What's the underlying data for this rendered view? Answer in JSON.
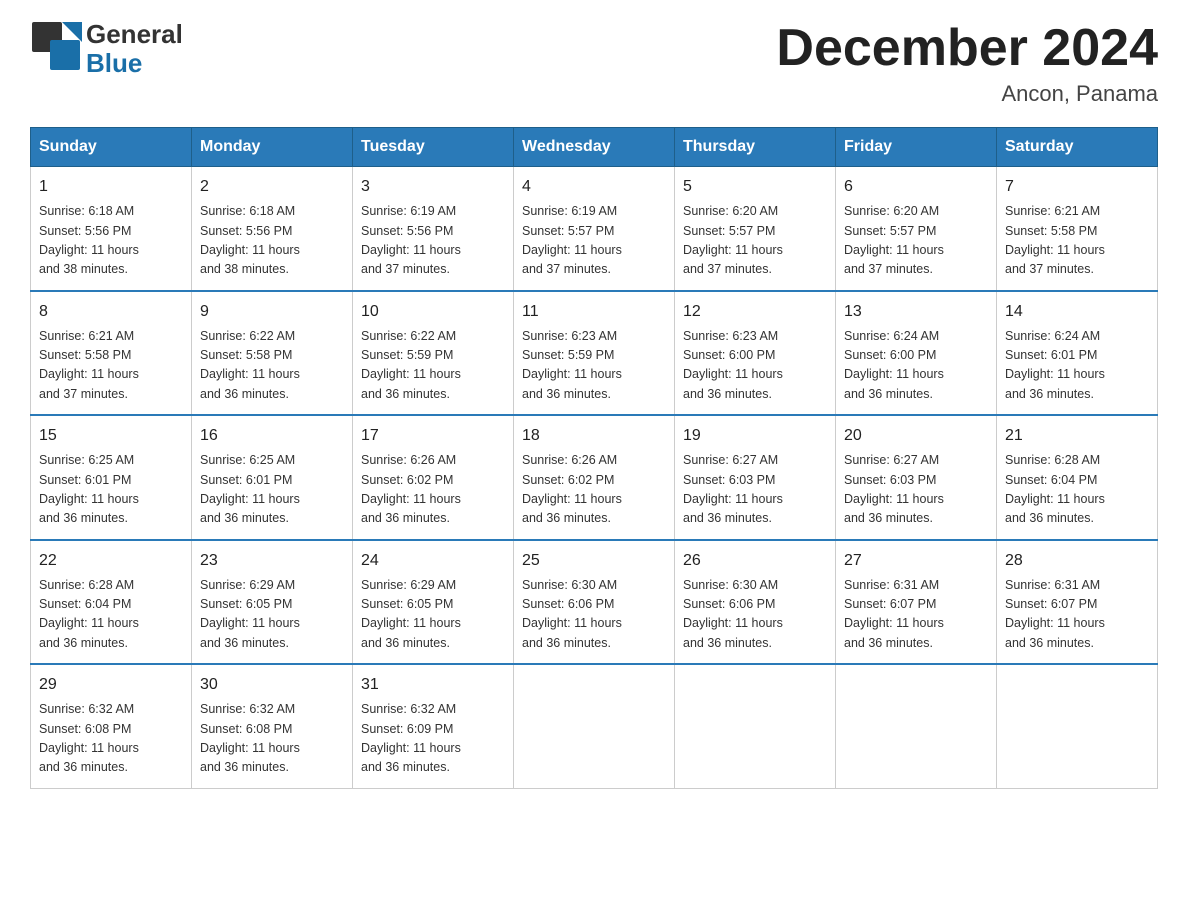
{
  "logo": {
    "general": "General",
    "blue": "Blue"
  },
  "title": "December 2024",
  "subtitle": "Ancon, Panama",
  "days_header": [
    "Sunday",
    "Monday",
    "Tuesday",
    "Wednesday",
    "Thursday",
    "Friday",
    "Saturday"
  ],
  "weeks": [
    [
      {
        "day": "1",
        "sunrise": "6:18 AM",
        "sunset": "5:56 PM",
        "daylight": "11 hours and 38 minutes."
      },
      {
        "day": "2",
        "sunrise": "6:18 AM",
        "sunset": "5:56 PM",
        "daylight": "11 hours and 38 minutes."
      },
      {
        "day": "3",
        "sunrise": "6:19 AM",
        "sunset": "5:56 PM",
        "daylight": "11 hours and 37 minutes."
      },
      {
        "day": "4",
        "sunrise": "6:19 AM",
        "sunset": "5:57 PM",
        "daylight": "11 hours and 37 minutes."
      },
      {
        "day": "5",
        "sunrise": "6:20 AM",
        "sunset": "5:57 PM",
        "daylight": "11 hours and 37 minutes."
      },
      {
        "day": "6",
        "sunrise": "6:20 AM",
        "sunset": "5:57 PM",
        "daylight": "11 hours and 37 minutes."
      },
      {
        "day": "7",
        "sunrise": "6:21 AM",
        "sunset": "5:58 PM",
        "daylight": "11 hours and 37 minutes."
      }
    ],
    [
      {
        "day": "8",
        "sunrise": "6:21 AM",
        "sunset": "5:58 PM",
        "daylight": "11 hours and 37 minutes."
      },
      {
        "day": "9",
        "sunrise": "6:22 AM",
        "sunset": "5:58 PM",
        "daylight": "11 hours and 36 minutes."
      },
      {
        "day": "10",
        "sunrise": "6:22 AM",
        "sunset": "5:59 PM",
        "daylight": "11 hours and 36 minutes."
      },
      {
        "day": "11",
        "sunrise": "6:23 AM",
        "sunset": "5:59 PM",
        "daylight": "11 hours and 36 minutes."
      },
      {
        "day": "12",
        "sunrise": "6:23 AM",
        "sunset": "6:00 PM",
        "daylight": "11 hours and 36 minutes."
      },
      {
        "day": "13",
        "sunrise": "6:24 AM",
        "sunset": "6:00 PM",
        "daylight": "11 hours and 36 minutes."
      },
      {
        "day": "14",
        "sunrise": "6:24 AM",
        "sunset": "6:01 PM",
        "daylight": "11 hours and 36 minutes."
      }
    ],
    [
      {
        "day": "15",
        "sunrise": "6:25 AM",
        "sunset": "6:01 PM",
        "daylight": "11 hours and 36 minutes."
      },
      {
        "day": "16",
        "sunrise": "6:25 AM",
        "sunset": "6:01 PM",
        "daylight": "11 hours and 36 minutes."
      },
      {
        "day": "17",
        "sunrise": "6:26 AM",
        "sunset": "6:02 PM",
        "daylight": "11 hours and 36 minutes."
      },
      {
        "day": "18",
        "sunrise": "6:26 AM",
        "sunset": "6:02 PM",
        "daylight": "11 hours and 36 minutes."
      },
      {
        "day": "19",
        "sunrise": "6:27 AM",
        "sunset": "6:03 PM",
        "daylight": "11 hours and 36 minutes."
      },
      {
        "day": "20",
        "sunrise": "6:27 AM",
        "sunset": "6:03 PM",
        "daylight": "11 hours and 36 minutes."
      },
      {
        "day": "21",
        "sunrise": "6:28 AM",
        "sunset": "6:04 PM",
        "daylight": "11 hours and 36 minutes."
      }
    ],
    [
      {
        "day": "22",
        "sunrise": "6:28 AM",
        "sunset": "6:04 PM",
        "daylight": "11 hours and 36 minutes."
      },
      {
        "day": "23",
        "sunrise": "6:29 AM",
        "sunset": "6:05 PM",
        "daylight": "11 hours and 36 minutes."
      },
      {
        "day": "24",
        "sunrise": "6:29 AM",
        "sunset": "6:05 PM",
        "daylight": "11 hours and 36 minutes."
      },
      {
        "day": "25",
        "sunrise": "6:30 AM",
        "sunset": "6:06 PM",
        "daylight": "11 hours and 36 minutes."
      },
      {
        "day": "26",
        "sunrise": "6:30 AM",
        "sunset": "6:06 PM",
        "daylight": "11 hours and 36 minutes."
      },
      {
        "day": "27",
        "sunrise": "6:31 AM",
        "sunset": "6:07 PM",
        "daylight": "11 hours and 36 minutes."
      },
      {
        "day": "28",
        "sunrise": "6:31 AM",
        "sunset": "6:07 PM",
        "daylight": "11 hours and 36 minutes."
      }
    ],
    [
      {
        "day": "29",
        "sunrise": "6:32 AM",
        "sunset": "6:08 PM",
        "daylight": "11 hours and 36 minutes."
      },
      {
        "day": "30",
        "sunrise": "6:32 AM",
        "sunset": "6:08 PM",
        "daylight": "11 hours and 36 minutes."
      },
      {
        "day": "31",
        "sunrise": "6:32 AM",
        "sunset": "6:09 PM",
        "daylight": "11 hours and 36 minutes."
      },
      null,
      null,
      null,
      null
    ]
  ],
  "labels": {
    "sunrise": "Sunrise:",
    "sunset": "Sunset:",
    "daylight": "Daylight:"
  }
}
